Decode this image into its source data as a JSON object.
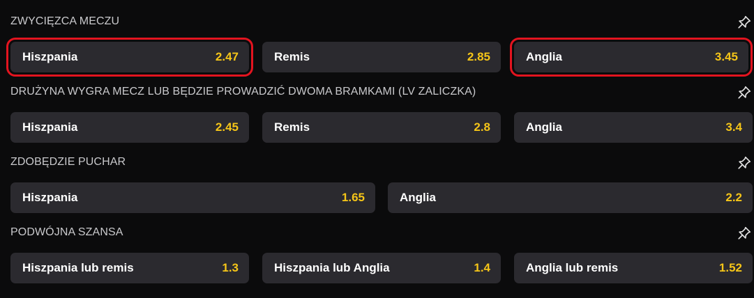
{
  "markets": [
    {
      "title": "ZWYCIĘZCA MECZU",
      "icon": "pin-icon",
      "options": [
        {
          "name": "Hiszpania",
          "odd": "2.47",
          "selected": true
        },
        {
          "name": "Remis",
          "odd": "2.85",
          "selected": false
        },
        {
          "name": "Anglia",
          "odd": "3.45",
          "selected": true
        }
      ]
    },
    {
      "title": "DRUŻYNA WYGRA MECZ LUB BĘDZIE PROWADZIĆ DWOMA BRAMKAMI (LV ZALICZKA)",
      "icon": "pin-icon",
      "options": [
        {
          "name": "Hiszpania",
          "odd": "2.45"
        },
        {
          "name": "Remis",
          "odd": "2.8"
        },
        {
          "name": "Anglia",
          "odd": "3.4"
        }
      ]
    },
    {
      "title": "ZDOBĘDZIE PUCHAR",
      "icon": "pin-icon",
      "options": [
        {
          "name": "Hiszpania",
          "odd": "1.65"
        },
        {
          "name": "Anglia",
          "odd": "2.2"
        }
      ]
    },
    {
      "title": "PODWÓJNA SZANSA",
      "icon": "pin-icon",
      "options": [
        {
          "name": "Hiszpania lub remis",
          "odd": "1.3"
        },
        {
          "name": "Hiszpania lub Anglia",
          "odd": "1.4"
        },
        {
          "name": "Anglia lub remis",
          "odd": "1.52"
        }
      ]
    }
  ],
  "colors": {
    "background": "#0b0b0c",
    "button": "#2b2a2f",
    "odd": "#f5c518",
    "highlight": "#e3141f",
    "title": "#c9c9cc"
  }
}
